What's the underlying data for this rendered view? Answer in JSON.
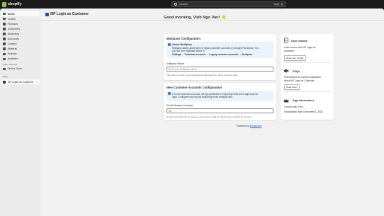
{
  "topbar": {
    "brand": "shopify",
    "search_placeholder": "Search",
    "shortcut_1": "CTRL",
    "shortcut_2": "K"
  },
  "sidebar": {
    "items": [
      {
        "label": "Home",
        "icon": "home-icon"
      },
      {
        "label": "Orders",
        "icon": "orders-icon"
      },
      {
        "label": "Products",
        "icon": "tag-icon"
      },
      {
        "label": "Customers",
        "icon": "person-icon"
      },
      {
        "label": "Marketing",
        "icon": "target-icon"
      },
      {
        "label": "Discounts",
        "icon": "discount-icon"
      },
      {
        "label": "Content",
        "icon": "content-icon"
      },
      {
        "label": "Markets",
        "icon": "globe-icon"
      },
      {
        "label": "Finance",
        "icon": "bank-icon"
      },
      {
        "label": "Analytics",
        "icon": "chart-icon"
      }
    ],
    "sales_channels_label": "Sales channels",
    "online_store": "Online Store",
    "apps_label": "Apps",
    "app_name": "MP Login as Customer"
  },
  "app_header": {
    "title": "MP Login as Customer"
  },
  "greeting": "Good morning, Vinh Ngo Van! 👋",
  "multipass_card": {
    "title": "Multipass Configuration",
    "info_title": "About Multipass",
    "info_text_1": "Multipass allows direct login for legacy customer accounts on Shopify Plus stores. You",
    "info_text_2": "can find your Multipass secret in:",
    "info_path": "Settings → Customer accounts → Legacy customer accounts → Multipass",
    "field_label": "Multipass Secret",
    "field_placeholder": "Enter your Multipass secret",
    "help": "This secret is used to generate secure login tokens for direct customer login."
  },
  "new_accounts_card": {
    "title": "New Customer Accounts Configuration",
    "info_text_1": "For new customer accounts, the app generates a temporary email and 6-digit code for",
    "info_text_2": "login. Configure how long the temporary email remains valid.",
    "field_label": "Email Lifespan (minutes)",
    "field_value": "20",
    "help": "Duration for which the temporary email remains valid (5-120 minutes). Default: 20 minutes."
  },
  "powered_by": {
    "label": "Powered by",
    "link": "Mageplaza"
  },
  "side": {
    "guides_title": "User Guides",
    "guides_text_1": "Learn how to use MP Login as",
    "guides_text_2": "Customer",
    "guides_btn": "Read User Guides",
    "faq_title": "FAQs",
    "faq_text_1": "Find answers to common questions",
    "faq_text_2": "about MP Login as Customer",
    "faq_btn": "Read FAQs",
    "info_title": "App Information",
    "plan": "Current plan: Free",
    "subscription": "Subscription date: December 5, 2025"
  }
}
